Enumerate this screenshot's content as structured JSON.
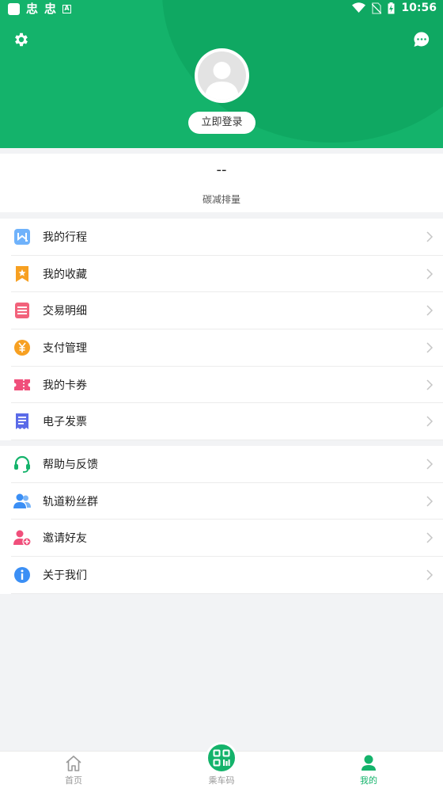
{
  "status_bar": {
    "time": "10:56",
    "glyph_1": "忠",
    "glyph_2": "忠",
    "a_badge": "A"
  },
  "profile": {
    "login_label": "立即登录"
  },
  "carbon": {
    "value": "--",
    "label": "碳减排量"
  },
  "menu_group_1": [
    {
      "label": "我的行程",
      "icon": "trip-icon",
      "color": "#3b8ff5"
    },
    {
      "label": "我的收藏",
      "icon": "bookmark-star-icon",
      "color": "#f7a021"
    },
    {
      "label": "交易明细",
      "icon": "transaction-list-icon",
      "color": "#f2627b"
    },
    {
      "label": "支付管理",
      "icon": "yuan-coin-icon",
      "color": "#f7a021"
    },
    {
      "label": "我的卡券",
      "icon": "ticket-icon",
      "color": "#f04f7b"
    },
    {
      "label": "电子发票",
      "icon": "receipt-icon",
      "color": "#5b6be8"
    }
  ],
  "menu_group_2": [
    {
      "label": "帮助与反馈",
      "icon": "headset-icon",
      "color": "#14b36b"
    },
    {
      "label": "轨道粉丝群",
      "icon": "group-icon",
      "color": "#3b8ff5"
    },
    {
      "label": "邀请好友",
      "icon": "add-friend-icon",
      "color": "#f04f7b"
    },
    {
      "label": "关于我们",
      "icon": "info-icon",
      "color": "#3b8ff5"
    }
  ],
  "tabbar": {
    "home": "首页",
    "qr": "乘车码",
    "mine": "我的"
  },
  "colors": {
    "brand": "#14b36b",
    "background": "#f2f3f5"
  }
}
